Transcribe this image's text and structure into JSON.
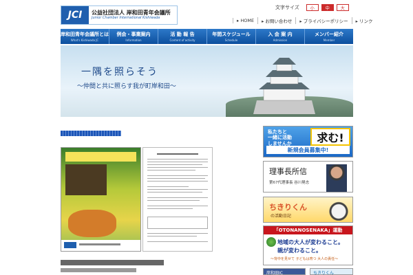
{
  "header": {
    "logo_mark": "JCI",
    "org_jp": "公益社団法人 岸和田青年会議所",
    "org_en": "Junior Chamber International Kishiwada",
    "font_size_label": "文字サイズ",
    "font_size_buttons": [
      "小",
      "中",
      "大"
    ],
    "util_nav": [
      "HOME",
      "お問い合わせ",
      "プライバシーポリシー",
      "リンク"
    ]
  },
  "nav": [
    {
      "jp": "岸和田青年会議所とは",
      "en": "What's Kishiwada JC"
    },
    {
      "jp": "例会・事業案内",
      "en": "Information"
    },
    {
      "jp": "活 動 報 告",
      "en": "Content of activity"
    },
    {
      "jp": "年間スケジュール",
      "en": "Schedule"
    },
    {
      "jp": "入 会 案 内",
      "en": "Admission"
    },
    {
      "jp": "メンバー紹介",
      "en": "Member"
    }
  ],
  "hero": {
    "slogan_main": "一隅を照らそう",
    "slogan_sub": "～仲間と共に照らす我が町岸和田～"
  },
  "banners": {
    "recruit": {
      "text1": "私たちと\n一緒に活動\nしませんか",
      "big": "求む!",
      "bar": "新規会員募集中!"
    },
    "message": {
      "title": "理事長所信",
      "sub": "第67代理事長 谷川晃志"
    },
    "chiki": {
      "title": "ちきりくん",
      "sub": "の活動日記"
    },
    "oto": {
      "head": "「OTONANOSENAKA」運動",
      "line1": "地域の大人が変わること。",
      "line2": "親が変わること。",
      "line3": "～背中を見せて 子どもは育つ 大人の責任～"
    },
    "facebook": "岸和田JC",
    "twitter": "ちきりくん"
  },
  "colors": {
    "nav_blue": "#1d5fae",
    "accent_red": "#cc2b2b"
  }
}
